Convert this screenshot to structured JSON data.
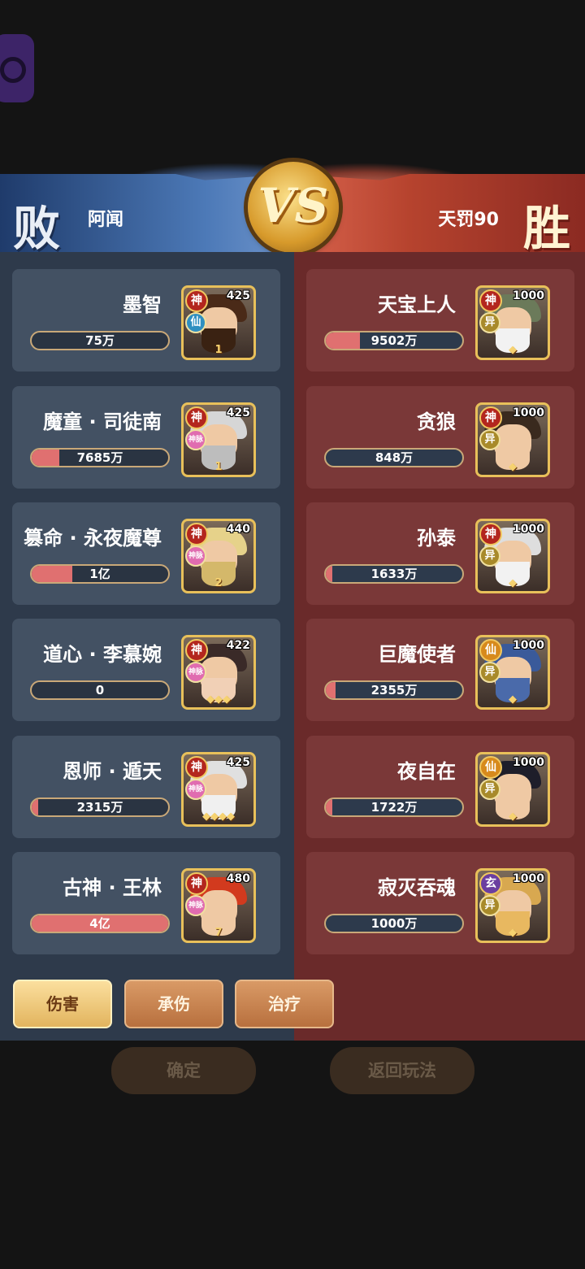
{
  "header": {
    "lose_label": "败",
    "win_label": "胜",
    "vs_label": "VS",
    "left_player": "阿闻",
    "right_player": "天罚90"
  },
  "left_team": [
    {
      "name": "墨智",
      "value": "75万",
      "fill": 0.0,
      "level": "425",
      "grade": "神",
      "sub": "仙",
      "stars": "1",
      "hair": "#4a2a18",
      "beard": "#3a2212"
    },
    {
      "name": "魔童 · 司徒南",
      "value": "7685万",
      "fill": 0.2,
      "level": "425",
      "grade": "神",
      "sub": "神脉",
      "stars": "1",
      "hair": "#d6d6d6",
      "beard": "#bdbdbd"
    },
    {
      "name": "篡命 · 永夜魔尊",
      "value": "1亿",
      "fill": 0.3,
      "level": "440",
      "grade": "神",
      "sub": "神脉",
      "stars": "2",
      "hair": "#e6d28a",
      "beard": "#d4b86a"
    },
    {
      "name": "道心 · 李慕婉",
      "value": "0",
      "fill": 0.0,
      "level": "422",
      "grade": "神",
      "sub": "神脉",
      "stars": "◆◆◆",
      "hair": "#3a2a28",
      "beard": "#f1d0b6"
    },
    {
      "name": "恩师 · 遁天",
      "value": "2315万",
      "fill": 0.05,
      "level": "425",
      "grade": "神",
      "sub": "神脉",
      "stars": "◆◆◆◆",
      "hair": "#e0e0e0",
      "beard": "#f0f0f0"
    },
    {
      "name": "古神 · 王林",
      "value": "4亿",
      "fill": 1.0,
      "level": "480",
      "grade": "神",
      "sub": "神脉",
      "stars": "7",
      "hair": "#d23a1e",
      "beard": "#efc9a4"
    }
  ],
  "right_team": [
    {
      "name": "天宝上人",
      "value": "9502万",
      "fill": 0.25,
      "level": "1000",
      "grade": "神",
      "grade_type": "shen",
      "sub": "异",
      "stars": "◆",
      "hair": "#6b7a5a",
      "beard": "#f2f2f2"
    },
    {
      "name": "贪狼",
      "value": "848万",
      "fill": 0.0,
      "level": "1000",
      "grade": "神",
      "grade_type": "shen",
      "sub": "异",
      "stars": "◆",
      "hair": "#3a2a1e",
      "beard": "#efc9a4"
    },
    {
      "name": "孙泰",
      "value": "1633万",
      "fill": 0.05,
      "level": "1000",
      "grade": "神",
      "grade_type": "shen",
      "sub": "异",
      "stars": "◆",
      "hair": "#dedede",
      "beard": "#f2f2f2"
    },
    {
      "name": "巨魔使者",
      "value": "2355万",
      "fill": 0.07,
      "level": "1000",
      "grade": "仙",
      "grade_type": "xian",
      "sub": "异",
      "stars": "◆",
      "hair": "#3a5a9a",
      "beard": "#4a6aaa"
    },
    {
      "name": "夜自在",
      "value": "1722万",
      "fill": 0.05,
      "level": "1000",
      "grade": "仙",
      "grade_type": "xian",
      "sub": "异",
      "stars": "◆",
      "hair": "#1e1e2a",
      "beard": "#efc9a4"
    },
    {
      "name": "寂灭吞魂",
      "value": "1000万",
      "fill": 0.0,
      "level": "1000",
      "grade": "玄",
      "grade_type": "xuan",
      "sub": "异",
      "stars": "◆",
      "hair": "#d8a850",
      "beard": "#e8b860"
    }
  ],
  "tabs": [
    "伤害",
    "承伤",
    "治疗"
  ],
  "buttons": {
    "confirm": "确定",
    "back": "返回玩法"
  }
}
